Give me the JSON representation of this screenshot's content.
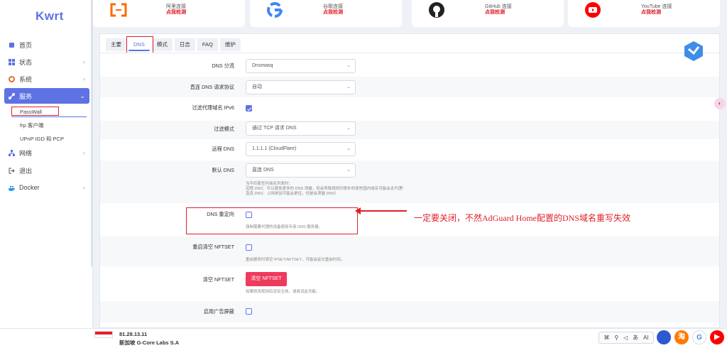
{
  "brand": "Kwrt",
  "sidebar": {
    "items": [
      {
        "label": "首页",
        "icon": "cube-icon"
      },
      {
        "label": "状态",
        "icon": "dashboard-icon"
      },
      {
        "label": "系统",
        "icon": "gear-icon"
      },
      {
        "label": "服务",
        "icon": "link-icon"
      },
      {
        "label": "网络",
        "icon": "network-icon"
      },
      {
        "label": "退出",
        "icon": "logout-icon"
      },
      {
        "label": "Docker",
        "icon": "docker-icon"
      }
    ],
    "sub_items": [
      "PassWall",
      "frp 客户端",
      "UPnP IGD 和 PCP"
    ]
  },
  "cards": [
    {
      "title": "阿里连接",
      "link": "点我检测",
      "icon": "alibaba-icon"
    },
    {
      "title": "谷歌连接",
      "link": "点我检测",
      "icon": "google-icon"
    },
    {
      "title": "GitHub 连接",
      "link": "点我检测",
      "icon": "github-icon"
    },
    {
      "title": "YouTube 连接",
      "link": "点我检测",
      "icon": "youtube-icon"
    }
  ],
  "tabs": [
    "主要",
    "DNS",
    "模式",
    "日志",
    "FAQ",
    "维护"
  ],
  "active_tab": "DNS",
  "form": {
    "dns_shunt": {
      "label": "DNS 分流",
      "value": "Dnsmasq"
    },
    "direct_protocol": {
      "label": "直连 DNS 请求协议",
      "value": "自动"
    },
    "filter_ipv6": {
      "label": "过滤代理域名 IPv6",
      "checked": true
    },
    "filter_mode": {
      "label": "过滤模式",
      "value": "通过 TCP 请求 DNS"
    },
    "remote_dns": {
      "label": "远程 DNS",
      "value": "1.1.1.1 (CloudFlare)"
    },
    "default_dns": {
      "label": "默认 DNS",
      "value": "直连 DNS",
      "hint1": "当不匹配任何域名列表时：",
      "hint2": "远程 DNS：可以避免更多的 DNS 泄露，但会导致规则列表外的某些国内域名可能会走代理！",
      "hint3": "直连 DNS：上网体验可能会更佳，但是会泄露 DNS！"
    },
    "dns_redirect": {
      "label": "DNS 重定向",
      "checked": false,
      "hint": "强制需要代理的设备使用专用 DNS 服务器。"
    },
    "restart_clear_nftset": {
      "label": "重启清空 NFTSET",
      "checked": false,
      "hint": "重启服务时清空 IPSET/NFTSET，可能会延长重启时间。"
    },
    "clear_nftset": {
      "label": "清空 NFTSET",
      "button": "清空 NFTSET",
      "hint": "如果修改规则后没有生效，请尝试此功能。"
    },
    "ad_block": {
      "label": "启用广告屏蔽",
      "checked": false
    }
  },
  "annotation": "一定要关闭，不然AdGuard Home配置的DNS域名重写失效",
  "footer": {
    "ip": "81.28.13.11",
    "isp": "新加坡 G-Core Labs S.A",
    "tray_items": [
      "⌘",
      "⚲",
      "◁",
      "あ",
      "AI"
    ]
  },
  "colors": {
    "accent": "#5e72e4",
    "annotation": "#e0202a",
    "button": "#ef3a5d"
  }
}
